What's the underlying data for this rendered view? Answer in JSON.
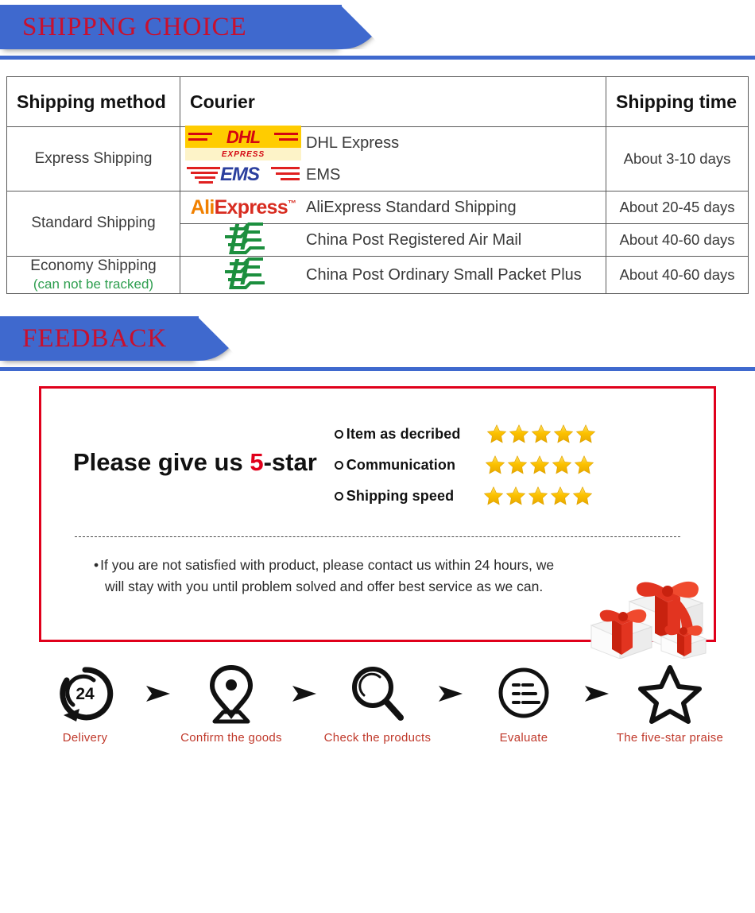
{
  "sections": {
    "shipping": {
      "banner_title": "SHIPPNG CHOICE"
    },
    "feedback": {
      "banner_title": "FEEDBACK"
    }
  },
  "shipping_table": {
    "headers": {
      "method": "Shipping method",
      "courier": "Courier",
      "time": "Shipping time"
    },
    "rows": [
      {
        "method": "Express Shipping",
        "method_note": "",
        "couriers": [
          {
            "logo": "dhl-logo",
            "label": "DHL Express"
          },
          {
            "logo": "ems-logo",
            "label": "EMS"
          }
        ],
        "time": "About  3-10 days"
      },
      {
        "method": "Standard Shipping",
        "method_note": "",
        "couriers": [
          {
            "logo": "aliexpress-logo",
            "label": "AliExpress Standard Shipping"
          }
        ],
        "time": "About 20-45 days"
      },
      {
        "method": "",
        "method_note": "",
        "couriers": [
          {
            "logo": "china-post-logo",
            "label": "China Post Registered Air Mail"
          }
        ],
        "time": "About 40-60 days"
      },
      {
        "method": "Economy Shipping",
        "method_note": "(can not be tracked)",
        "couriers": [
          {
            "logo": "china-post-logo",
            "label": "China Post Ordinary Small Packet Plus"
          }
        ],
        "time": "About 40-60 days"
      }
    ],
    "logo_text": {
      "dhl_main": "DHL",
      "dhl_sub": "EXPRESS",
      "ems_main": "EMS",
      "ali_part1": "Ali",
      "ali_part2": "Express",
      "ali_tm": "™"
    }
  },
  "feedback": {
    "headline_prefix": "Please give us ",
    "headline_number": "5",
    "headline_suffix": "-star",
    "ratings": [
      {
        "label": "Item as decribed",
        "stars": 5
      },
      {
        "label": "Communication",
        "stars": 5
      },
      {
        "label": "Shipping speed",
        "stars": 5
      }
    ],
    "note_bullet": "•",
    "note_line1": "If you are not satisfied with product, please contact us within 24 hours, we",
    "note_line2": "will stay with you until problem solved and offer best service as we can."
  },
  "steps": [
    {
      "icon": "clock-24-hours-icon",
      "label": "Delivery"
    },
    {
      "icon": "location-pin-icon",
      "label": "Confirm the goods"
    },
    {
      "icon": "magnifier-icon",
      "label": "Check the products"
    },
    {
      "icon": "checklist-circle-icon",
      "label": "Evaluate"
    },
    {
      "icon": "star-outline-icon",
      "label": "The five-star praise"
    }
  ],
  "arrow_separator_icon": "arrow-right-icon",
  "colors": {
    "banner_blue": "#3f69ce",
    "banner_red_text": "#c8102e",
    "feedback_border_red": "#e0001b",
    "star_gold": "#f5c518",
    "step_label_red": "#c0392b",
    "dhl_yellow": "#ffcc00",
    "dhl_red": "#d40511",
    "ems_blue": "#2b3f9e",
    "ems_red": "#e02020",
    "ali_orange": "#f08000",
    "ali_red": "#d82c20",
    "china_post_green": "#1c8f3e",
    "method_note_green": "#2e9e4f"
  }
}
